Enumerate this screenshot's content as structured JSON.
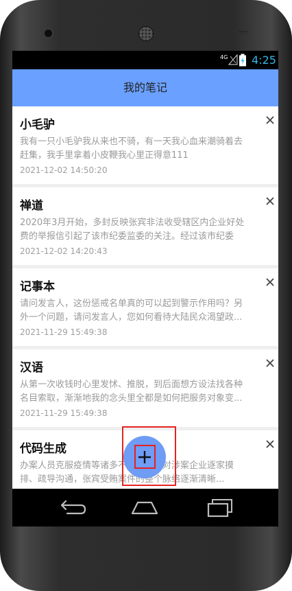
{
  "status": {
    "network": "4G",
    "time": "4:25"
  },
  "appbar": {
    "title": "我的笔记"
  },
  "notes": [
    {
      "title": "小毛驴",
      "lines": [
        "我有一只小毛驴我从来也不骑，有一天我心血来潮骑着去",
        "赶集，我手里拿着小皮鞭我心里正得意111"
      ],
      "date": "2021-12-02 14:50:20"
    },
    {
      "title": "禅道",
      "lines": [
        "2020年3月开始，多封反映张宾非法收受辖区内企业好处",
        "费的举报信引起了该市纪委监委的关注。经过该市纪委"
      ],
      "date": "2021-12-02 14:20:43"
    },
    {
      "title": "记事本",
      "lines": [
        "请问发言人，这份惩戒名单真的可以起到警示作用吗？另",
        "外一个问题，请问发言人，您如何看待大陆民众渴望政..."
      ],
      "date": "2021-11-29 15:49:38"
    },
    {
      "title": "汉语",
      "lines": [
        "从第一次收钱时心里发怵、推脱，到后面想方设法找各种",
        "名目索取，渐渐地我的念头里全都是如何把服务对象变..."
      ],
      "date": "2021-11-29 15:49:38"
    },
    {
      "title": "代码生成",
      "lines": [
        "办案人员克服疫情等诸多不利影响，对涉案企业逐家摸",
        "排、疏导沟通，张宾受贿案件的整个脉络逐渐清晰..."
      ],
      "date": ""
    }
  ],
  "fab": {
    "label": "+"
  },
  "icons": {
    "close": "close-icon",
    "back": "back-icon",
    "home": "home-icon",
    "recents": "recents-icon",
    "add": "plus-icon"
  },
  "colors": {
    "appbar": "#6aa0ff",
    "fab": "#6f9cf4",
    "statusTime": "#33b5e5",
    "highlight": "#e52222"
  }
}
